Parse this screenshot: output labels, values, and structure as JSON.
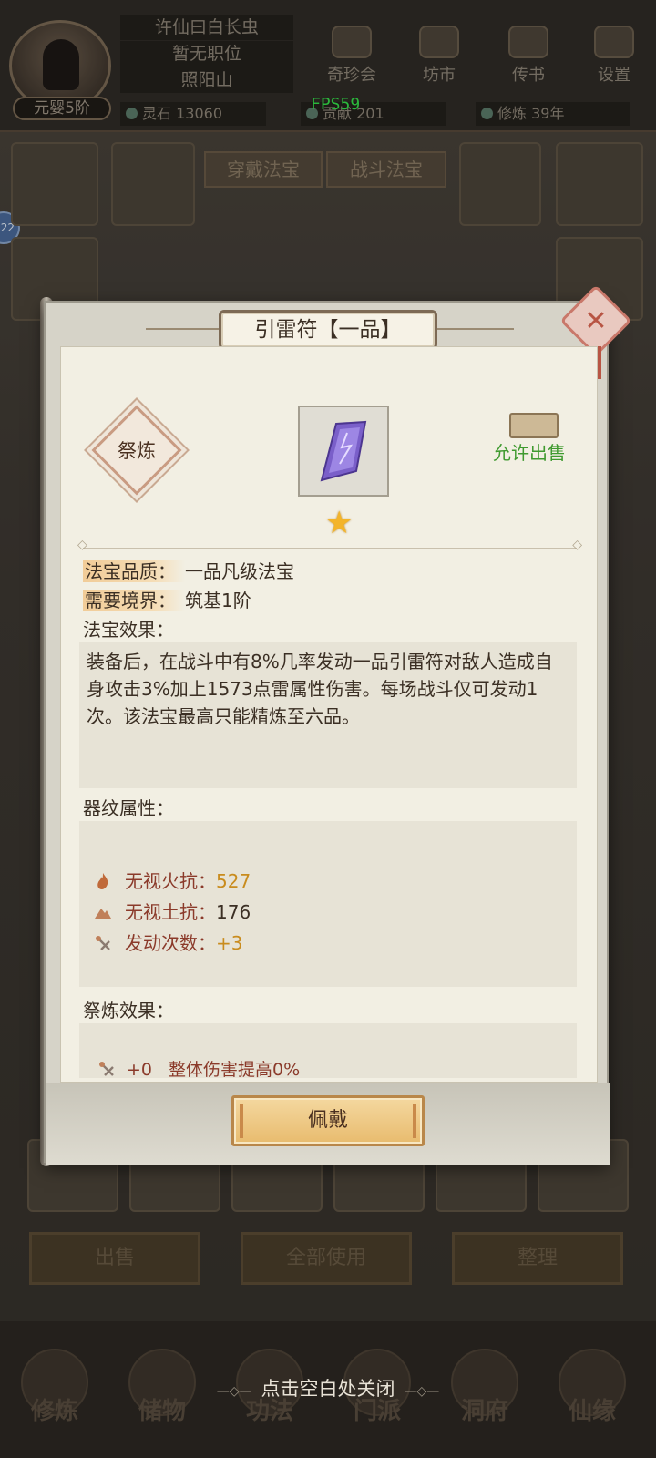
{
  "player": {
    "name": "许仙曰白长虫",
    "position": "暂无职位",
    "location": "照阳山",
    "realm": "元婴5阶"
  },
  "resources": {
    "spirit_stone_label": "灵石",
    "spirit_stone_value": "13060",
    "contribution_label": "贡献",
    "contribution_value": "201",
    "cultivation_label": "修炼",
    "cultivation_value": "39年"
  },
  "fps": "FPS59",
  "side_badge": "22",
  "top_menu": [
    {
      "label": "奇珍会",
      "icon": "treasure-pavilion-icon"
    },
    {
      "label": "坊市",
      "icon": "market-icon"
    },
    {
      "label": "传书",
      "icon": "letter-scroll-icon"
    },
    {
      "label": "设置",
      "icon": "gear-icon"
    }
  ],
  "equip_tabs": {
    "worn": "穿戴法宝",
    "battle": "战斗法宝"
  },
  "bag_buttons": {
    "sell": "出售",
    "use_all": "全部使用",
    "sort": "整理"
  },
  "nav": [
    "修炼",
    "储物",
    "功法",
    "门派",
    "洞府",
    "仙缘"
  ],
  "close_hint": "点击空白处关闭",
  "modal": {
    "title": "引雷符【一品】",
    "refine_label": "祭炼",
    "sell_label": "允许出售",
    "item_icon": "purple-talisman-icon",
    "stars": "★",
    "quality_key": "法宝品质：",
    "quality_value": "一品凡级法宝",
    "realm_key": "需要境界：",
    "realm_value": "筑基1阶",
    "effect_label": "法宝效果：",
    "effect_text": "装备后，在战斗中有8%几率发动一品引雷符对敌人造成自身攻击3%加上1573点雷属性伤害。每场战斗仅可发动1次。该法宝最高只能精炼至六品。",
    "pattern_label": "器纹属性：",
    "attributes": [
      {
        "name": "无视火抗：",
        "value": "527",
        "icon": "flame-icon",
        "value_color": "#c98c1e"
      },
      {
        "name": "无视土抗：",
        "value": "176",
        "icon": "mountain-icon",
        "value_color": "#3b2f24"
      },
      {
        "name": "发动次数：",
        "value": "+3",
        "icon": "trigger-arrow-icon",
        "value_color": "#c98c1e"
      }
    ],
    "refine_effect_label": "祭炼效果：",
    "refine_effect_plus": "+0",
    "refine_effect_text": "整体伤害提高0%",
    "wear_button": "佩戴"
  }
}
